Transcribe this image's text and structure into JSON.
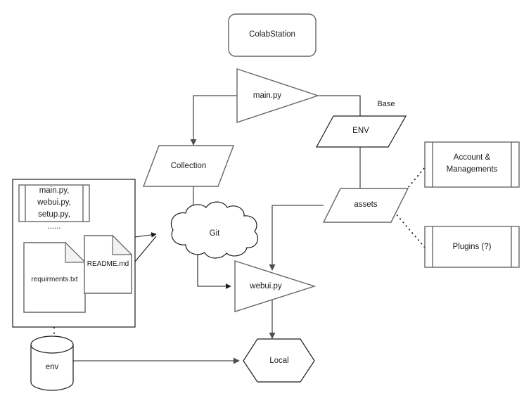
{
  "diagram": {
    "title": "ColabStation",
    "nodes": {
      "colabstation": {
        "label": "ColabStation",
        "shape": "rounded-rectangle"
      },
      "main_py": {
        "label": "main.py",
        "shape": "triangle"
      },
      "collection": {
        "label": "Collection",
        "shape": "parallelogram"
      },
      "env_node": {
        "label": "ENV",
        "shape": "parallelogram"
      },
      "assets": {
        "label": "assets",
        "shape": "parallelogram"
      },
      "account_managements": {
        "label": "Account &\nManagements",
        "shape": "predefined-process"
      },
      "plugins": {
        "label": "Plugins (?)",
        "shape": "predefined-process"
      },
      "repo_container": {
        "label": "",
        "shape": "rectangle"
      },
      "source_files": {
        "label": "main.py,\nwebui.py,\nsetup.py,\n......",
        "shape": "predefined-process"
      },
      "requirements": {
        "label": "requirments.txt",
        "shape": "document"
      },
      "readme": {
        "label": "README.md",
        "shape": "document"
      },
      "git": {
        "label": "Git",
        "shape": "cloud"
      },
      "webui_py": {
        "label": "webui.py",
        "shape": "triangle"
      },
      "local": {
        "label": "Local",
        "shape": "hexagon"
      },
      "env_store": {
        "label": "env",
        "shape": "cylinder"
      }
    },
    "edge_labels": {
      "base": "Base"
    },
    "colors": {
      "shape_stroke": "#666666",
      "dark_stroke": "#1a1a1a",
      "connector": "#4d4d4d",
      "fold_fill": "#f2f2f2",
      "background": "#ffffff",
      "text": "#1a1a1a"
    }
  }
}
